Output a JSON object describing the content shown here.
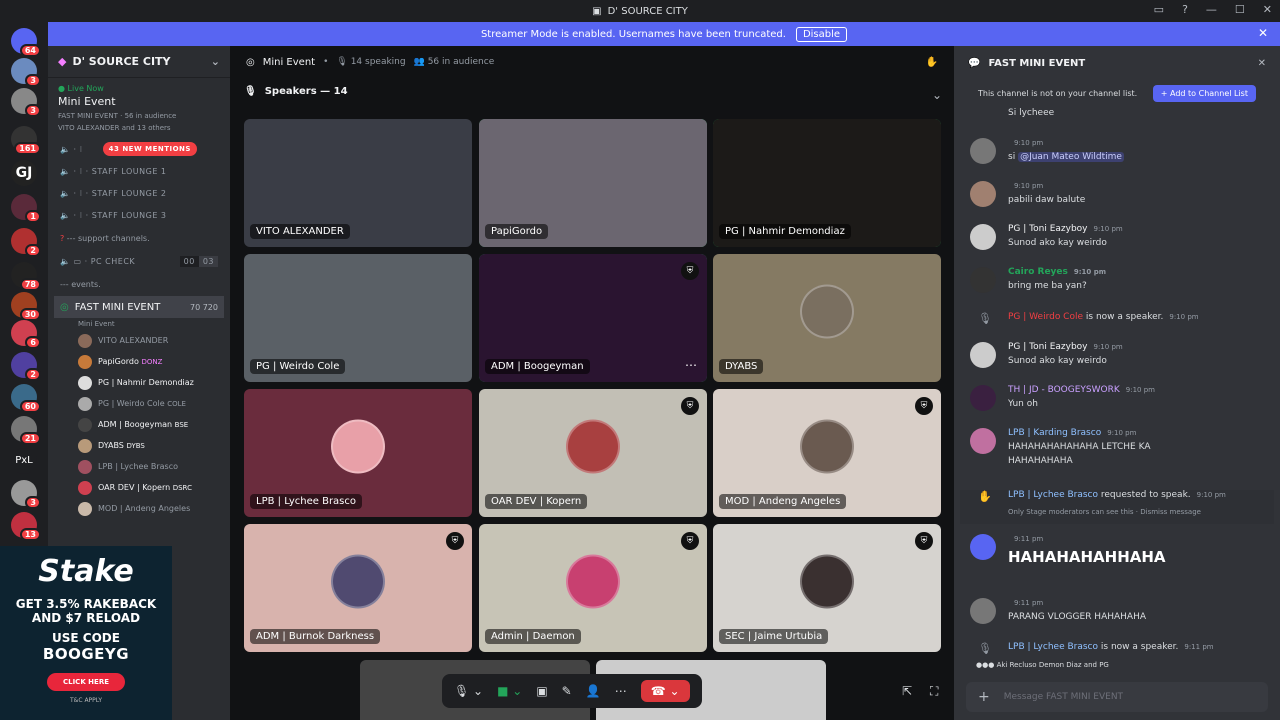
{
  "window": {
    "title": "D' SOURCE CITY"
  },
  "banner": {
    "text": "Streamer Mode is enabled. Usernames have been truncated.",
    "button": "Disable"
  },
  "guild_badges": [
    "64",
    "3",
    "3",
    "161",
    "1",
    "2",
    "78",
    "30",
    "6",
    "2",
    "60",
    "21",
    "PxL",
    "3",
    "13"
  ],
  "sidebar": {
    "server_name": "D' SOURCE CITY",
    "live_now": "Live Now",
    "event_name": "Mini Event",
    "event_channel": "FAST MINI EVENT",
    "audience": "56 in audience",
    "attendees": "VITO ALEXANDER and 13 others",
    "mentions_badge": "43 NEW MENTIONS",
    "channels": [
      "STAFF LOUNGE 1",
      "STAFF LOUNGE 2",
      "STAFF LOUNGE 3"
    ],
    "category_support": "--- support channels.",
    "pc_check": "PC CHECK",
    "pc_check_counts": [
      "00",
      "03"
    ],
    "category_events": "--- events.",
    "stage_channel": "FAST MINI EVENT",
    "stage_counts": [
      "70",
      "720"
    ],
    "stage_sub": "Mini Event",
    "members": [
      {
        "name": "VITO ALEXANDER",
        "tag": ""
      },
      {
        "name": "PapiGordo",
        "tag": "DONZ"
      },
      {
        "name": "PG | Nahmir Demondiaz",
        "tag": ""
      },
      {
        "name": "PG | Weirdo Cole",
        "tag": "COLE"
      },
      {
        "name": "ADM | Boogeyman",
        "tag": "BSE"
      },
      {
        "name": "DYABS",
        "tag": "DYBS"
      },
      {
        "name": "LPB | Lychee Brasco",
        "tag": ""
      },
      {
        "name": "OAR DEV | Kopern",
        "tag": "DSRC"
      },
      {
        "name": "MOD | Andeng Angeles",
        "tag": ""
      },
      {
        "name": "rkness",
        "tag": ""
      },
      {
        "name": "",
        "tag": "DAYA"
      }
    ]
  },
  "ad": {
    "logo": "Stake",
    "line1": "GET 3.5% RAKEBACK",
    "line1b": "AND $7 RELOAD",
    "line2": "USE CODE",
    "code": "BOOGEYG",
    "button": "CLICK HERE",
    "tc": "T&C APPLY"
  },
  "stage": {
    "title": "Mini Event",
    "speaking": "14 speaking",
    "audience": "56 in audience",
    "speakers_header": "Speakers — 14",
    "tiles": [
      {
        "name": "VITO ALEXANDER",
        "bg": "#3a3d46"
      },
      {
        "name": "PapiGordo",
        "bg": "#6b6670"
      },
      {
        "name": "PG | Nahmir Demondiaz",
        "bg": "#1c1a18"
      },
      {
        "name": "PG | Weirdo Cole",
        "bg": "#5a6066"
      },
      {
        "name": "ADM | Boogeyman",
        "bg": "#2a1430"
      },
      {
        "name": "DYABS",
        "bg": "#857a63"
      },
      {
        "name": "LPB | Lychee Brasco",
        "bg": "#6a2c3d"
      },
      {
        "name": "OAR DEV | Kopern",
        "bg": "#c2bfb5"
      },
      {
        "name": "MOD | Andeng Angeles",
        "bg": "#d9cfc8"
      },
      {
        "name": "ADM | Burnok Darkness",
        "bg": "#d8b3ad"
      },
      {
        "name": "Admin | Daemon",
        "bg": "#c7c4b6"
      },
      {
        "name": "SEC | Jaime Urtubia",
        "bg": "#d6d3cf"
      }
    ]
  },
  "chat": {
    "channel": "FAST MINI EVENT",
    "notice": "This channel is not on your channel list.",
    "add_button": "+ Add to Channel List",
    "messages": [
      {
        "name": "",
        "text": "Si lycheee",
        "time": ""
      },
      {
        "name": "",
        "text": "si @Juan Mateo Wildtime",
        "time": "9:10 pm"
      },
      {
        "name": "",
        "text": "pabili daw balute",
        "time": "9:10 pm"
      },
      {
        "name": "PG | Toni Eazyboy",
        "text": "Sunod ako kay weirdo",
        "time": "9:10 pm"
      },
      {
        "name": "Cairo Reyes",
        "text": "bring me ba yan?",
        "time": "9:10 pm"
      },
      {
        "name": "PG | Weirdo Cole",
        "text": "is now a speaker.",
        "time": "9:10 pm"
      },
      {
        "name": "PG | Toni Eazyboy",
        "text": "Sunod ako kay weirdo",
        "time": "9:10 pm"
      },
      {
        "name": "TH | JD - BOOGEYSWORK",
        "text": "Yun oh",
        "time": "9:10 pm"
      },
      {
        "name": "LPB | Karding Brasco",
        "text": "HAHAHAHAHAHAHA LETCHE KA",
        "text2": "HAHAHAHAHA",
        "time": "9:10 pm"
      },
      {
        "name": "LPB | Lychee Brasco",
        "text": "requested to speak.",
        "time": "9:10 pm",
        "note": "Only Stage moderators can see this · Dismiss message"
      },
      {
        "name": "",
        "text": "HAHAHAHAHHAHA",
        "time": "9:11 pm"
      },
      {
        "name": "",
        "text": "PARANG VLOGGER HAHAHAHA",
        "time": "9:11 pm"
      },
      {
        "name": "LPB | Lychee Brasco",
        "text": "is now a speaker.",
        "time": "9:11 pm"
      }
    ],
    "typing": "Aki Recluso Demon Diaz and PG",
    "input_placeholder": "Message FAST MINI EVENT"
  }
}
